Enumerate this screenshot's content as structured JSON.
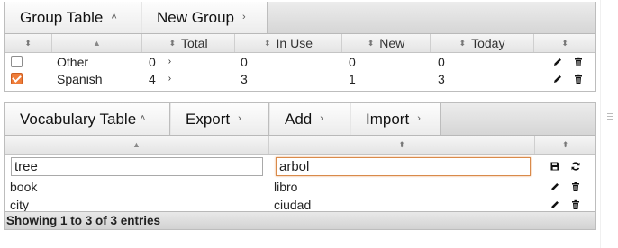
{
  "group_table": {
    "toolbar": {
      "group_table_label": "Group Table",
      "new_group_label": "New Group"
    },
    "columns": {
      "total": "Total",
      "in_use": "In Use",
      "new": "New",
      "today": "Today"
    },
    "rows": [
      {
        "checked": false,
        "name": "Other",
        "total": "0",
        "in_use": "0",
        "new": "0",
        "today": "0"
      },
      {
        "checked": true,
        "name": "Spanish",
        "total": "4",
        "in_use": "3",
        "new": "1",
        "today": "3"
      }
    ]
  },
  "vocab_table": {
    "toolbar": {
      "vocabulary_table_label": "Vocabulary Table",
      "export_label": "Export",
      "add_label": "Add",
      "import_label": "Import"
    },
    "edit_row": {
      "word_value": "tree",
      "translation_value": "arbol"
    },
    "rows": [
      {
        "word": "book",
        "translation": "libro"
      },
      {
        "word": "city",
        "translation": "ciudad"
      }
    ],
    "footer": "Showing 1 to 3 of 3 entries"
  },
  "icons": {
    "sort": "sort-both-icon",
    "sort_asc": "sort-asc-icon",
    "chevron": "chevron-right-icon",
    "chevron_up": "chevron-up-icon",
    "edit": "pencil-icon",
    "delete": "trash-icon",
    "save": "floppy-disk-icon",
    "cancel": "refresh-icon"
  },
  "colors": {
    "accent": "#ef7d3a",
    "focus_border": "#d98a4a"
  }
}
